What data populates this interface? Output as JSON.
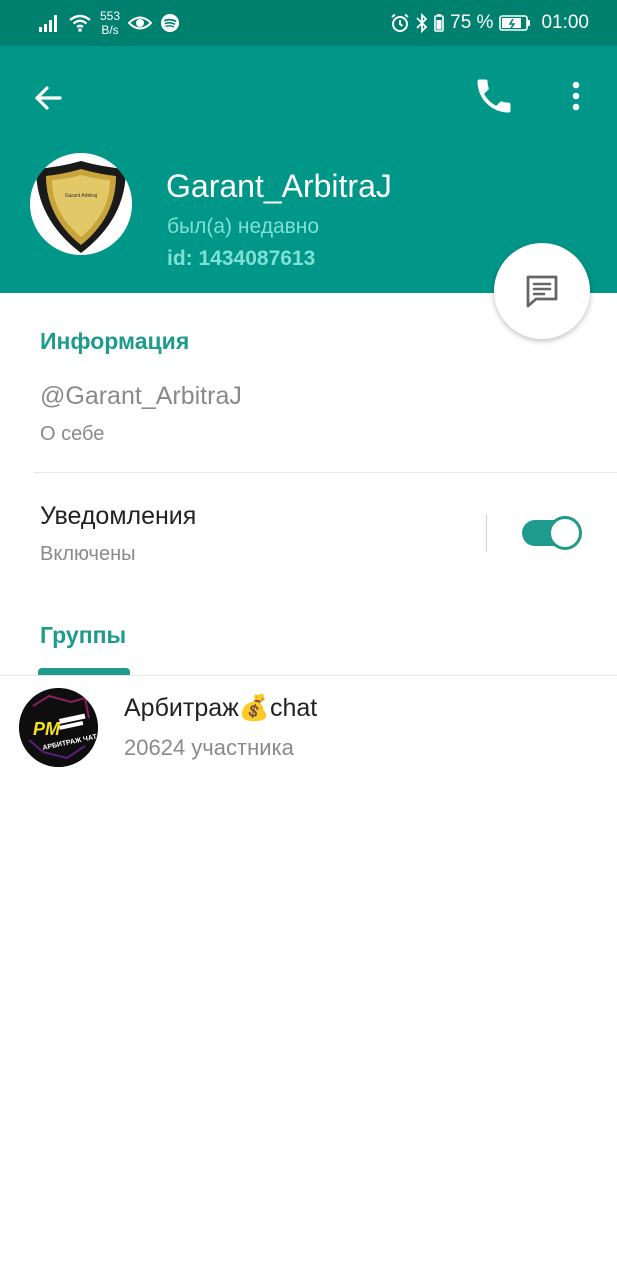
{
  "status_bar": {
    "speed_value": "553",
    "speed_unit": "B/s",
    "battery": "75 %",
    "time": "01:00"
  },
  "profile": {
    "name": "Garant_ArbitraJ",
    "last_seen": "был(а) недавно",
    "id": "id: 1434087613",
    "avatar_text": "Garant Arbitraj"
  },
  "info": {
    "title": "Информация",
    "username": "@Garant_ArbitraJ",
    "bio_label": "О себе"
  },
  "notifications": {
    "label": "Уведомления",
    "state": "Включены",
    "enabled": true
  },
  "groups": {
    "title": "Группы",
    "items": [
      {
        "name": "Арбитраж💰chat",
        "members": "20624 участника",
        "avatar_mark": "PM",
        "avatar_caption": "АРБИТРАЖ ЧАТ"
      }
    ]
  },
  "colors": {
    "status_bar": "#00806f",
    "app_bar": "#009688",
    "accent": "#1f9b8e",
    "subtitle": "#7fe0d5"
  }
}
